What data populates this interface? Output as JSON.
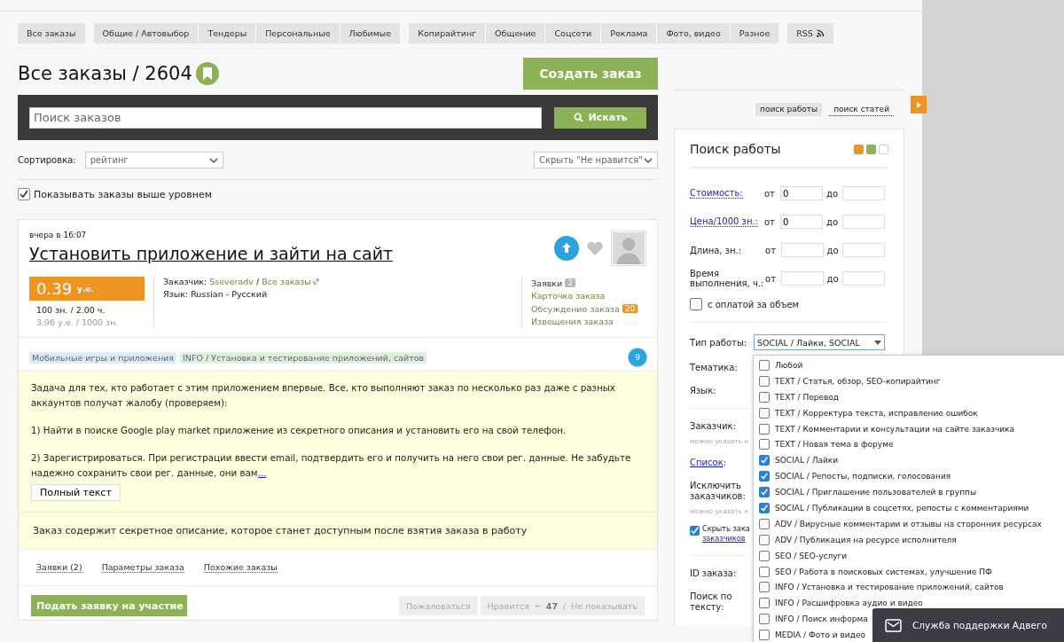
{
  "nav_groups": [
    [
      {
        "label": "Все заказы",
        "selected": false
      }
    ],
    [
      {
        "label": "Общие / Автовыбор",
        "selected": false
      },
      {
        "label": "Тендеры",
        "selected": false
      },
      {
        "label": "Персональные",
        "selected": false
      },
      {
        "label": "Любимые",
        "selected": false
      }
    ],
    [
      {
        "label": "Копирайтинг",
        "selected": false
      },
      {
        "label": "Общение",
        "selected": false
      },
      {
        "label": "Соцсети",
        "selected": false
      },
      {
        "label": "Реклама",
        "selected": false
      },
      {
        "label": "Фото, видео",
        "selected": false
      },
      {
        "label": "Разное",
        "selected": false
      }
    ],
    [
      {
        "label": "RSS",
        "selected": false
      }
    ]
  ],
  "page_title": "Все заказы / 2604",
  "create_button": "Создать заказ",
  "search": {
    "placeholder": "Поиск заказов",
    "button": "Искать"
  },
  "sort": {
    "label": "Сортировка:",
    "value": "рейтинг",
    "filter": "Скрыть \"Не нравится\""
  },
  "show_higher": {
    "label": "Показывать заказы выше уровнем",
    "checked": true
  },
  "order": {
    "time": "вчера в 16:07",
    "title": "Установить приложение и зайти на сайт",
    "price": "0.39",
    "currency": "у.е.",
    "volume": "100 зн. / 2.00 ч.",
    "rate": "3.96 у.е. / 1000 зн.",
    "customer_label": "Заказчик:",
    "customer": "Sseveradv",
    "customer_separator": "/",
    "all_orders": "Все заказы",
    "language_label": "Язык:",
    "language": "Russian - Русский",
    "links": [
      {
        "label": "Заявки",
        "badge": "2",
        "color": "#b5b5b5",
        "kind": "plain"
      },
      {
        "label": "Карточка заказа",
        "kind": "link"
      },
      {
        "label": "Обсуждение заказа",
        "badge": "20",
        "color": "#ee9420",
        "kind": "link"
      },
      {
        "label": "Извещения заказа",
        "kind": "link"
      }
    ],
    "tags": [
      {
        "label": "Мобильные игры и приложения",
        "color": "#dcecf7"
      },
      {
        "label": "INFO / Установка и тестирование приложений, сайтов",
        "color": "#dff0d8"
      }
    ],
    "level_badge": "9",
    "description": [
      "Задача для тех, кто работает с этим приложением впервые. Все, кто выполняют заказ по несколько раз даже с разных аккаунтов получат жалобу (проверяем):",
      "1) Найти в поиске Google play market приложение из секретного описания и установить его на свой телефон.",
      "2) Зарегистрироваться. При регистрации ввести email, подтвердить его и получить на него свои рег. данные. Не забудьте надежно сохранить свои рег. данные, они вам"
    ],
    "more_link": "...",
    "full_text_button": "Полный текст",
    "secret_note": "Заказ содержит секретное описание, которое станет доступным после взятия заказа в работу",
    "tabs": [
      {
        "label": "Заявки (2)",
        "selected": false
      },
      {
        "label": "Параметры заказа",
        "selected": false
      },
      {
        "label": "Похожие заказы",
        "selected": false
      }
    ],
    "apply_button": "Подать заявку на участие",
    "complain": "Пожаловаться",
    "like": "Нравится",
    "likes": "47",
    "separator": "/",
    "hide": "Не показывать"
  },
  "sidebar": {
    "tabs": [
      {
        "label": "поиск работы",
        "selected": true
      },
      {
        "label": "поиск статей",
        "selected": false
      }
    ],
    "title": "Поиск работы",
    "swatches": [
      {
        "color": "#ee9420",
        "selected": false
      },
      {
        "color": "#8db255",
        "selected": false
      },
      {
        "color": "#ffffff",
        "selected": false
      }
    ],
    "ranges": [
      {
        "label": "Стоимость:",
        "kind": "link",
        "from_label": "от",
        "from": "0",
        "to_label": "до"
      },
      {
        "label": "Цена/1000 зн.:",
        "kind": "link",
        "from_label": "от",
        "from": "0",
        "to_label": "до"
      },
      {
        "label": "Длина, зн.:",
        "kind": "plain",
        "from_label": "от",
        "to_label": "до"
      },
      {
        "label": "Время выполнения, ч.:",
        "kind": "plain",
        "from_label": "от",
        "to_label": "до"
      }
    ],
    "volume_pay": {
      "label": "с оплатой за объем",
      "checked": false
    },
    "work_type": {
      "label": "Тип работы:",
      "value": "SOCIAL / Лайки, SOCIAL"
    },
    "fields": [
      {
        "label": "Тематика:",
        "kind": "label"
      },
      {
        "label": "Язык:",
        "kind": "label"
      },
      {
        "kind": "rule"
      },
      {
        "label": "Заказчик:",
        "kind": "label"
      },
      {
        "label": "можно указать н",
        "kind": "hint"
      },
      {
        "label": "Список",
        "suffix": ":",
        "kind": "link"
      },
      {
        "label": "Исключить заказчиков:",
        "kind": "label"
      },
      {
        "label": "можно указать н",
        "kind": "hint"
      },
      {
        "label": "Скрыть зака",
        "link": "заказчиков",
        "kind": "check",
        "checked": true
      },
      {
        "kind": "rule"
      },
      {
        "label": "ID заказа:",
        "kind": "label"
      },
      {
        "label": "Поиск по тексту:",
        "kind": "label"
      }
    ]
  },
  "work_types": [
    {
      "label": "Любой",
      "checked": false
    },
    {
      "label": "TEXT / Статья, обзор, SEO-копирайтинг",
      "checked": false
    },
    {
      "label": "TEXT / Перевод",
      "checked": false
    },
    {
      "label": "TEXT / Корректура текста, исправление ошибок",
      "checked": false
    },
    {
      "label": "TEXT / Комментарии и консультации на сайте заказчика",
      "checked": false
    },
    {
      "label": "TEXT / Новая тема в форуме",
      "checked": false
    },
    {
      "label": "SOCIAL / Лайки",
      "checked": true
    },
    {
      "label": "SOCIAL / Репосты, подписки, голосования",
      "checked": true
    },
    {
      "label": "SOCIAL / Приглашение пользователей в группы",
      "checked": true
    },
    {
      "label": "SOCIAL / Публикации в соцсетях, репосты с комментариями",
      "checked": true
    },
    {
      "label": "ADV / Вирусные комментарии и отзывы на сторонних ресурсах",
      "checked": false
    },
    {
      "label": "ADV / Публикация на ресурсе исполнителя",
      "checked": false
    },
    {
      "label": "SEO / SEO-услуги",
      "checked": false
    },
    {
      "label": "SEO / Работа в поисковых системах, улучшение ПФ",
      "checked": false
    },
    {
      "label": "INFO / Установка и тестирование приложений, сайтов",
      "checked": false
    },
    {
      "label": "INFO / Расшифровка аудио и видео",
      "checked": false
    },
    {
      "label": "INFO / Поиск информа",
      "checked": false
    },
    {
      "label": "MEDIA / Фото и видео",
      "checked": false
    }
  ],
  "support": {
    "label": "Служба поддержки Адвего"
  }
}
